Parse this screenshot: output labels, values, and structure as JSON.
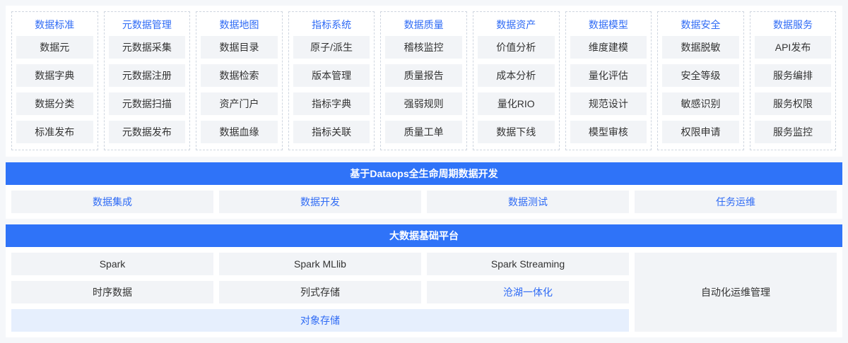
{
  "governance": {
    "columns": [
      {
        "title": "数据标准",
        "items": [
          "数据元",
          "数据字典",
          "数据分类",
          "标准发布"
        ]
      },
      {
        "title": "元数据管理",
        "items": [
          "元数据采集",
          "元数据注册",
          "元数据扫描",
          "元数据发布"
        ]
      },
      {
        "title": "数据地图",
        "items": [
          "数据目录",
          "数据检索",
          "资产门户",
          "数据血缘"
        ]
      },
      {
        "title": "指标系统",
        "items": [
          "原子/派生",
          "版本管理",
          "指标字典",
          "指标关联"
        ]
      },
      {
        "title": "数据质量",
        "items": [
          "稽核监控",
          "质量报告",
          "强弱规则",
          "质量工单"
        ]
      },
      {
        "title": "数据资产",
        "items": [
          "价值分析",
          "成本分析",
          "量化RIO",
          "数据下线"
        ]
      },
      {
        "title": "数据模型",
        "items": [
          "维度建模",
          "量化评估",
          "规范设计",
          "模型审核"
        ]
      },
      {
        "title": "数据安全",
        "items": [
          "数据脱敏",
          "安全等级",
          "敏感识别",
          "权限申请"
        ]
      },
      {
        "title": "数据服务",
        "items": [
          "API发布",
          "服务编排",
          "服务权限",
          "服务监控"
        ]
      }
    ]
  },
  "dataops": {
    "title": "基于Dataops全生命周期数据开发",
    "items": [
      "数据集成",
      "数据开发",
      "数据测试",
      "任务运维"
    ]
  },
  "platform": {
    "title": "大数据基础平台",
    "row1": [
      "Spark",
      "Spark MLlib",
      "Spark Streaming"
    ],
    "row2": [
      "时序数据",
      "列式存储",
      "沧湖一体化"
    ],
    "storage": "对象存储",
    "ops": "自动化运维管理"
  },
  "colors": {
    "accent": "#2f73f8",
    "link_text": "#2f6bf5",
    "cell_bg": "#f2f4f7",
    "storage_bg": "#e6effd"
  }
}
